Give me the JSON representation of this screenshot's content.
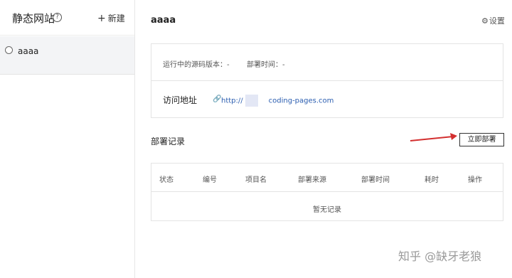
{
  "sidebar": {
    "title": "静态网站",
    "help_icon": "?",
    "new_label": "新建",
    "items": [
      {
        "label": "aaaa"
      }
    ]
  },
  "main": {
    "title": "aaaa",
    "settings_label": "设置",
    "info": {
      "source_version": "运行中的源码版本：-",
      "deploy_time": "部署时间：-",
      "address_label": "访问地址",
      "address_prefix": "http://",
      "address_suffix": "coding-pages.com"
    },
    "records": {
      "title": "部署记录",
      "deploy_button": "立即部署",
      "columns": [
        "状态",
        "编号",
        "项目名",
        "部署来源",
        "部署时间",
        "耗时",
        "操作"
      ],
      "empty_text": "暂无记录"
    }
  },
  "watermark": "知乎 @缺牙老狼",
  "colors": {
    "link": "#2a5db0",
    "arrow": "#d32f2f",
    "selected_bg": "#f3f4f6"
  }
}
